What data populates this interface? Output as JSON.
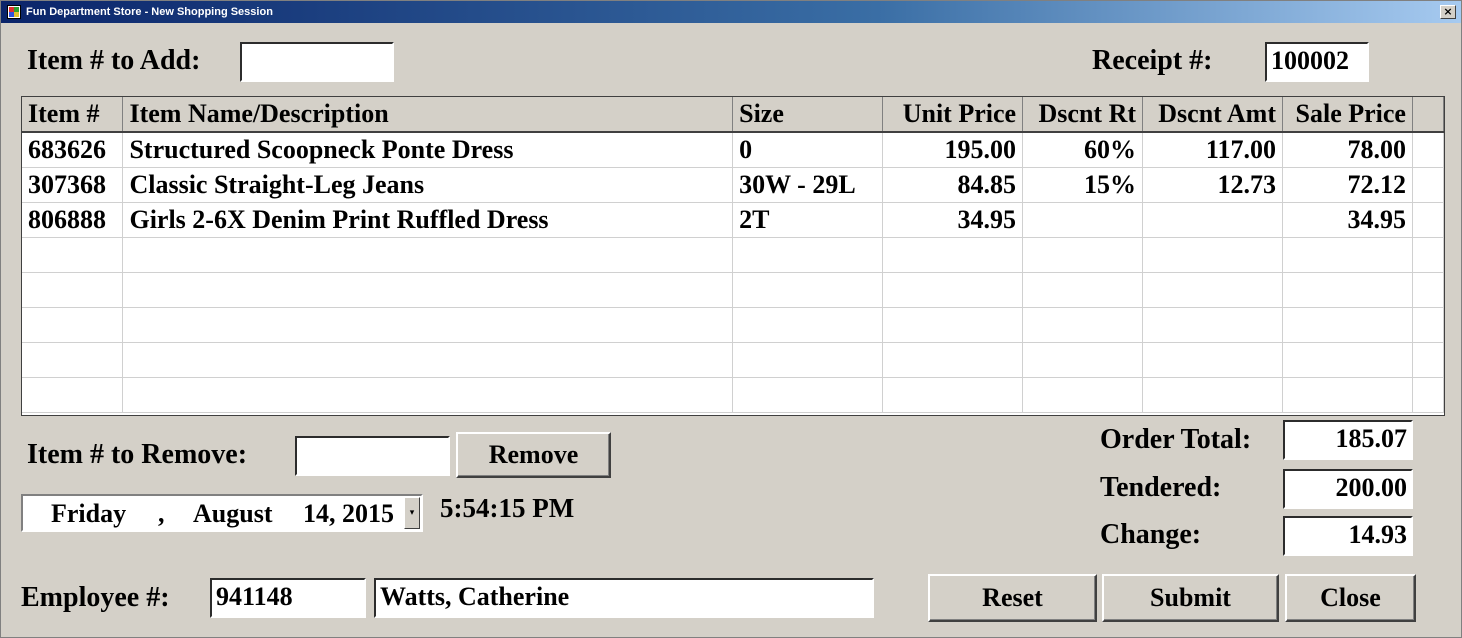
{
  "window": {
    "title": "Fun Department Store - New Shopping Session",
    "close_glyph": "×"
  },
  "add": {
    "label": "Item # to Add:",
    "value": ""
  },
  "receipt": {
    "label": "Receipt #:",
    "value": "100002"
  },
  "grid": {
    "columns": [
      "Item #",
      "Item Name/Description",
      "Size",
      "Unit Price",
      "Dscnt Rt",
      "Dscnt Amt",
      "Sale Price"
    ],
    "rows": [
      [
        "683626",
        "Structured Scoopneck Ponte Dress",
        "0",
        "195.00",
        "60%",
        "117.00",
        "78.00"
      ],
      [
        "307368",
        "Classic Straight-Leg Jeans",
        "30W - 29L",
        "84.85",
        "15%",
        "12.73",
        "72.12"
      ],
      [
        "806888",
        "Girls 2-6X Denim Print Ruffled Dress",
        "2T",
        "34.95",
        "",
        "",
        "34.95"
      ],
      [
        "",
        "",
        "",
        "",
        "",
        "",
        ""
      ],
      [
        "",
        "",
        "",
        "",
        "",
        "",
        ""
      ],
      [
        "",
        "",
        "",
        "",
        "",
        "",
        ""
      ],
      [
        "",
        "",
        "",
        "",
        "",
        "",
        ""
      ],
      [
        "",
        "",
        "",
        "",
        "",
        "",
        ""
      ]
    ]
  },
  "remove": {
    "label": "Item # to Remove:",
    "value": "",
    "button": "Remove"
  },
  "date": {
    "weekday": "Friday",
    "sep": ",",
    "month": "August",
    "day_year": "14, 2015",
    "dropdown_glyph": "▾"
  },
  "time": "5:54:15 PM",
  "totals": {
    "order_total_label": "Order Total:",
    "order_total": "185.07",
    "tendered_label": "Tendered:",
    "tendered": "200.00",
    "change_label": "Change:",
    "change": "14.93"
  },
  "employee": {
    "label": "Employee #:",
    "number": "941148",
    "name": "Watts, Catherine"
  },
  "buttons": {
    "reset": "Reset",
    "submit": "Submit",
    "close": "Close"
  },
  "colors": {
    "window_bg": "#d4d0c8",
    "titlebar": "#0a246a"
  }
}
